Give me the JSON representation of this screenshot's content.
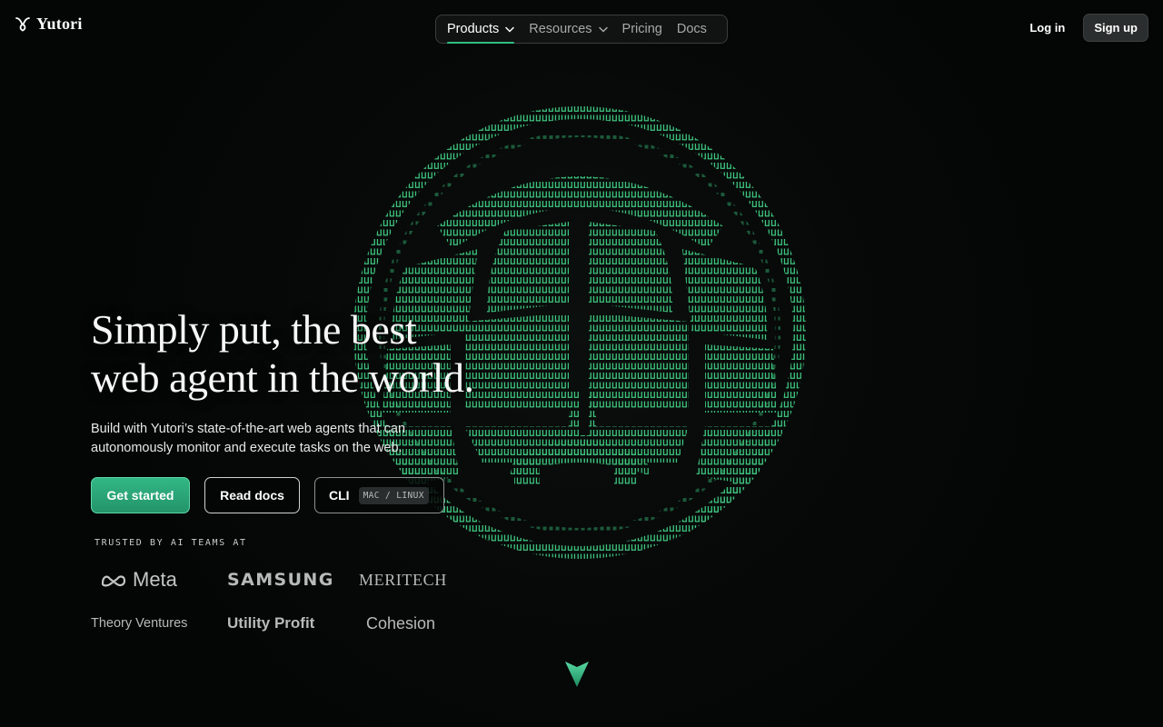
{
  "brand": {
    "name": "Yutori"
  },
  "nav": {
    "items": [
      {
        "label": "Products",
        "has_dropdown": true,
        "active": true
      },
      {
        "label": "Resources",
        "has_dropdown": true,
        "active": false
      },
      {
        "label": "Pricing",
        "has_dropdown": false,
        "active": false
      },
      {
        "label": "Docs",
        "has_dropdown": false,
        "active": false
      }
    ]
  },
  "auth": {
    "login_label": "Log in",
    "signup_label": "Sign up"
  },
  "hero": {
    "title_line1": "Simply put, the best",
    "title_line2": "web agent in the world.",
    "subtitle": "Build with Yutori’s state-of-the-art web agents that can autonomously monitor and execute tasks on the web.",
    "buttons": {
      "get_started": "Get started",
      "read_docs": "Read docs",
      "cli": "CLI",
      "cli_badge": "MAC / LINUX"
    }
  },
  "trusted": {
    "heading": "TRUSTED BY AI TEAMS AT",
    "logos": [
      "Meta",
      "SAMSUNG",
      "MERITECH",
      "Theory Ventures",
      "Utility Profit",
      "Cohesion"
    ]
  },
  "icons": {
    "logo": "yutori-mark-icon",
    "dropdown": "chevron-down-icon",
    "meta": "meta-infinity-icon",
    "scroll": "arrow-down-icon",
    "hero_art": "ascii-globe-icon"
  },
  "colors": {
    "background": "#050606",
    "accent_green": "#2fbf83",
    "ascii_green": "#3ec47d",
    "text_primary": "#f6f7f6",
    "text_muted": "#a5aaa8"
  }
}
